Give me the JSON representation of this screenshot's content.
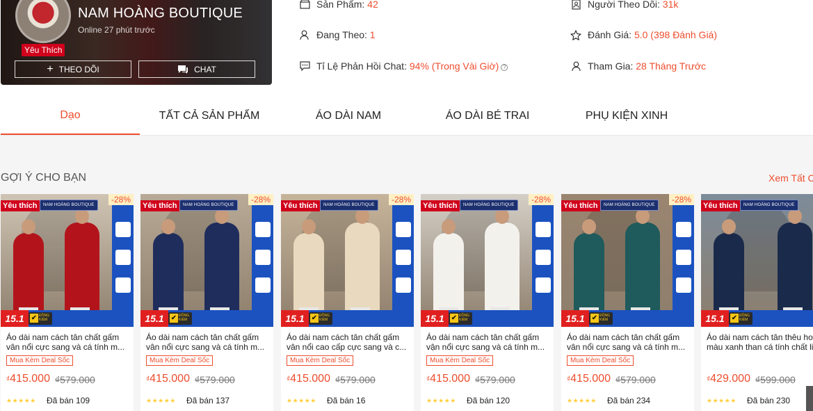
{
  "shop": {
    "name": "NAM HOÀNG BOUTIQUE",
    "online": "Online 27 phút trước",
    "favorite_badge": "Yêu Thích",
    "follow_label": "THEO DÕI",
    "chat_label": "CHAT"
  },
  "stats": {
    "products_label": "Sản Phẩm:",
    "products_value": "42",
    "following_label": "Đang Theo:",
    "following_value": "1",
    "chat_rate_label": "Tỉ Lệ Phản Hồi Chat:",
    "chat_rate_value": "94% (Trong Vài Giờ)",
    "followers_label": "Người Theo Dõi:",
    "followers_value": "31k",
    "rating_label": "Đánh Giá:",
    "rating_value": "5.0 (398 Đánh Giá)",
    "joined_label": "Tham Gia:",
    "joined_value": "28 Tháng Trước"
  },
  "tabs": [
    "Dạo",
    "TẤT CẢ SẢN PHẨM",
    "ÁO DÀI NAM",
    "ÁO DÀI BÉ TRAI",
    "PHỤ KIỆN XINH"
  ],
  "section": {
    "title": "GỢI Ý CHO BẠN",
    "see_all": "Xem Tất C"
  },
  "products": [
    {
      "name": "Áo dài nam cách tân chất gấm vân nổi cực sang và cá tính m...",
      "fav": "Yêu thích",
      "brand": "NAM HOÀNG BOUTIQUE",
      "discount": "-28%",
      "badge_date": "15.1",
      "deal": "Mua Kèm Deal Sốc",
      "currency": "₫",
      "price": "415.000",
      "old_price": "₫579.000",
      "stars": "★★★★★",
      "sold": "Đã bán 109",
      "color": "#b3141c"
    },
    {
      "name": "Áo dài nam cách tân chất gấm vân nổi cực sang và cá tính m...",
      "fav": "Yêu thích",
      "brand": "NAM HOÀNG BOUTIQUE",
      "discount": "-28%",
      "badge_date": "15.1",
      "deal": "Mua Kèm Deal Sốc",
      "currency": "₫",
      "price": "415.000",
      "old_price": "₫579.000",
      "stars": "★★★★★",
      "sold": "Đã bán 137",
      "color": "#1f2d5c"
    },
    {
      "name": "Áo dài nam cách tân chất gấm vân nổi cao cấp cực sang và c...",
      "fav": "Yêu thích",
      "brand": "NAM HOÀNG BOUTIQUE",
      "discount": "-28%",
      "badge_date": "15.1",
      "deal": "Mua Kèm Deal Sốc",
      "currency": "₫",
      "price": "415.000",
      "old_price": "₫579.000",
      "stars": "★★★★★",
      "sold": "Đã bán 16",
      "color": "#e9d9bf"
    },
    {
      "name": "Áo dài nam cách tân chất gấm vận nổi cực sang và cá tính m...",
      "fav": "Yêu thích",
      "brand": "NAM HOÀNG BOUTIQUE",
      "discount": "-28%",
      "badge_date": "15.1",
      "deal": "Mua Kèm Deal Sốc",
      "currency": "₫",
      "price": "415.000",
      "old_price": "₫579.000",
      "stars": "★★★★★",
      "sold": "Đã bán 120",
      "color": "#f3f1ec"
    },
    {
      "name": "Áo dài nam cách tân chất gấm vân nổi cực sang và cá tính m...",
      "fav": "Yêu thích",
      "brand": "NAM HOÀNG BOUTIQUE",
      "discount": "-28%",
      "badge_date": "15.1",
      "deal": "Mua Kèm Deal Sốc",
      "currency": "₫",
      "price": "415.000",
      "old_price": "₫579.000",
      "stars": "★★★★★",
      "sold": "Đã bán 234",
      "color": "#1f5a5c"
    },
    {
      "name": "Áo dài nam cách tân thêu hoa màu xanh than cá tính chất lin",
      "fav": "Yêu thích",
      "brand": "NAM HOÀNG BOUTIQUE",
      "discount": "",
      "badge_date": "15.1",
      "deal": "",
      "currency": "₫",
      "price": "429.000",
      "old_price": "₫599.000",
      "stars": "★★★★★",
      "sold": "Đã bán 230",
      "color": "#1a2a4a"
    }
  ],
  "colors": {
    "accent": "#ee4d2d",
    "badge_red": "#d0011b",
    "strip_blue": "#1b52c0"
  },
  "icons": [
    "plus-icon",
    "chat-icon",
    "store-icon",
    "user-follow-icon",
    "message-icon",
    "followers-icon",
    "star-icon",
    "user-joined-icon",
    "help-icon"
  ]
}
